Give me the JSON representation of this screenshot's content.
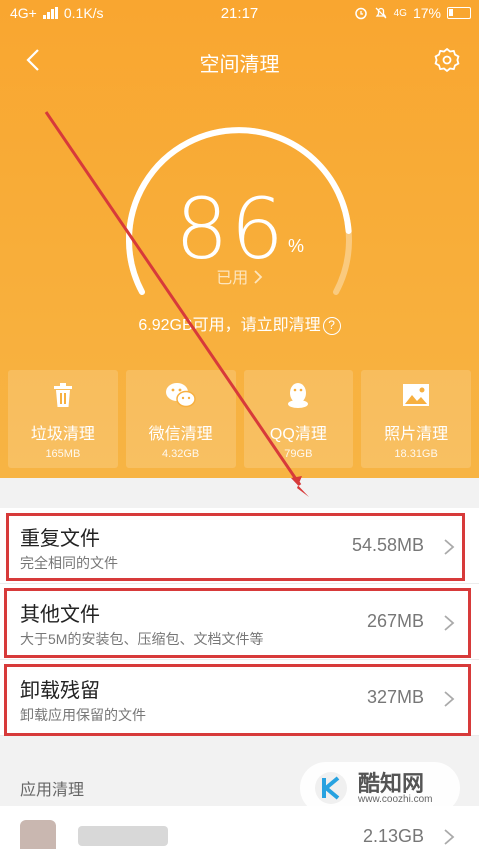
{
  "status": {
    "network": "4G+",
    "speed": "0.1K/s",
    "time": "21:17",
    "net2": "4G",
    "battery": "17%"
  },
  "nav": {
    "title": "空间清理",
    "back_icon": "chevron-left-icon",
    "settings_icon": "gear-icon"
  },
  "storage": {
    "percent": "86",
    "percent_sign": "%",
    "used_label": "已用",
    "available": "6.92GB可用，请立即清理",
    "used_fraction": 0.86
  },
  "tiles": [
    {
      "icon": "trash-icon",
      "label": "垃圾清理",
      "size": "165MB"
    },
    {
      "icon": "wechat-icon",
      "label": "微信清理",
      "size": "4.32GB"
    },
    {
      "icon": "qq-icon",
      "label": "QQ清理",
      "size": "79GB"
    },
    {
      "icon": "photo-icon",
      "label": "照片清理",
      "size": "18.31GB"
    }
  ],
  "rows": [
    {
      "name": "重复文件",
      "desc": "完全相同的文件",
      "size": "54.58MB"
    },
    {
      "name": "其他文件",
      "desc": "大于5M的安装包、压缩包、文档文件等",
      "size": "267MB"
    },
    {
      "name": "卸载残留",
      "desc": "卸载应用保留的文件",
      "size": "327MB"
    }
  ],
  "app_section": {
    "title": "应用清理",
    "first_size": "2.13GB"
  },
  "watermark": {
    "text": "酷知网",
    "url": "www.coozhi.com"
  },
  "colors": {
    "accent": "#f9a630",
    "highlight": "#d73a3a"
  }
}
